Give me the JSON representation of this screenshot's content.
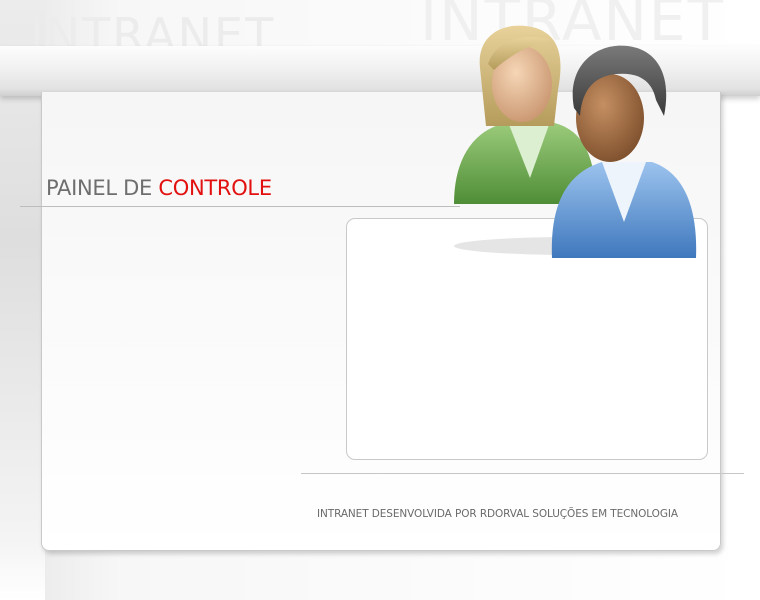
{
  "watermarks": [
    "INTRANET",
    "INTRANET"
  ],
  "page_title": {
    "prefix": "PAINEL DE",
    "accent": "CONTROLE"
  },
  "footer": {
    "text": "INTRANET DESENVOLVIDA POR RDORVAL SOLUÇÕES EM TECNOLOGIA"
  },
  "icons": {
    "hero": "users-icon"
  },
  "colors": {
    "accent": "#e31010",
    "title_gray": "#6e6e6e",
    "female_shirt": "#6ea84e",
    "male_shirt": "#5c93cf"
  }
}
